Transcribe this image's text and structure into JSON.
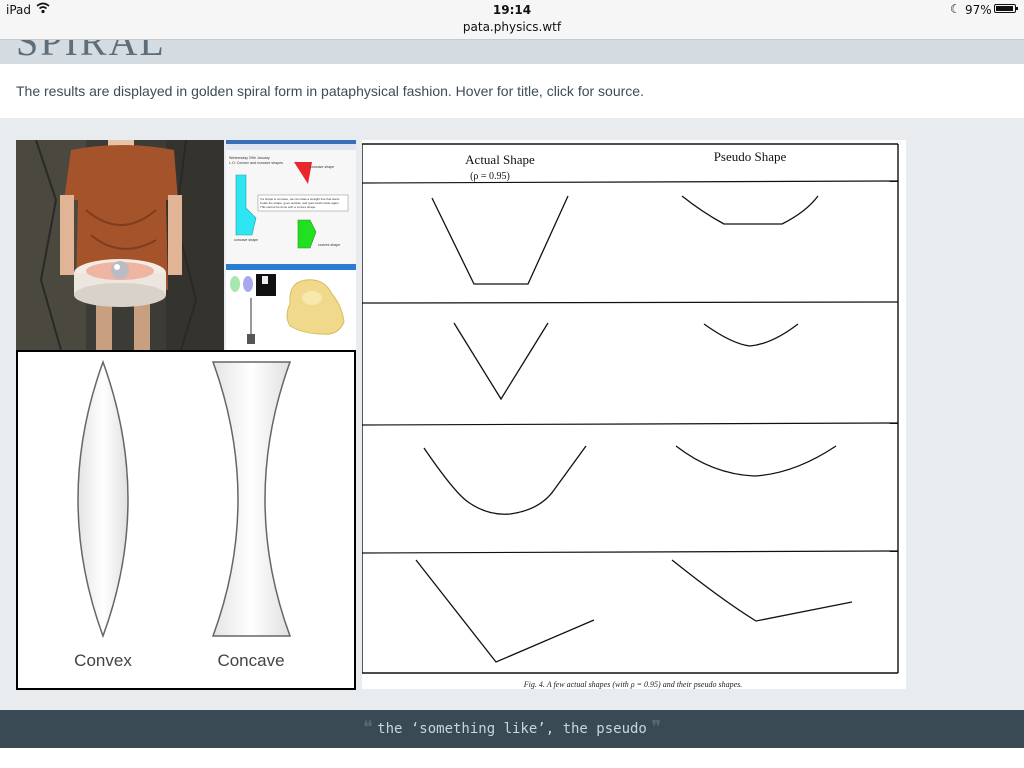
{
  "status_bar": {
    "device": "iPad",
    "time": "19:14",
    "url": "pata.physics.wtf",
    "battery": "97%",
    "battery_level": 0.97,
    "icons": [
      "wifi-icon",
      "moon-icon",
      "battery-icon"
    ]
  },
  "page": {
    "heading_partial": "SPIRAL",
    "intro": "The results are displayed in golden spiral form in pataphysical fashion. Hover for title, click for source."
  },
  "mosaic": {
    "concave_screen": {
      "title": "Wednesday 29th January",
      "subtitle": "L.O: Convex and concave shapes",
      "shape_label_top": "concave shape",
      "shape_label_left": "concave shape",
      "shape_label_right": "convex shape",
      "note": "If a shape is concave, we can draw a straight line that starts inside the shape, goes outside, and goes back inside again. This cannot be done with a convex shape."
    },
    "lens": {
      "convex_label": "Convex",
      "concave_label": "Concave"
    },
    "shapes_figure": {
      "col_actual": "Actual  Shape",
      "col_actual_sub": "(ρ  =  0.95)",
      "col_pseudo": "Pseudo  Shape",
      "caption": "Fig. 4.  A few actual shapes (with ρ = 0.95) and their pseudo shapes."
    }
  },
  "quote": {
    "open": "❝",
    "text": "the ‘something like’, the pseudo",
    "close": "❞"
  },
  "colors": {
    "quote_bar": "#3a4a54",
    "heading_band": "#d5dce1",
    "intro_text": "#3d4c56"
  }
}
